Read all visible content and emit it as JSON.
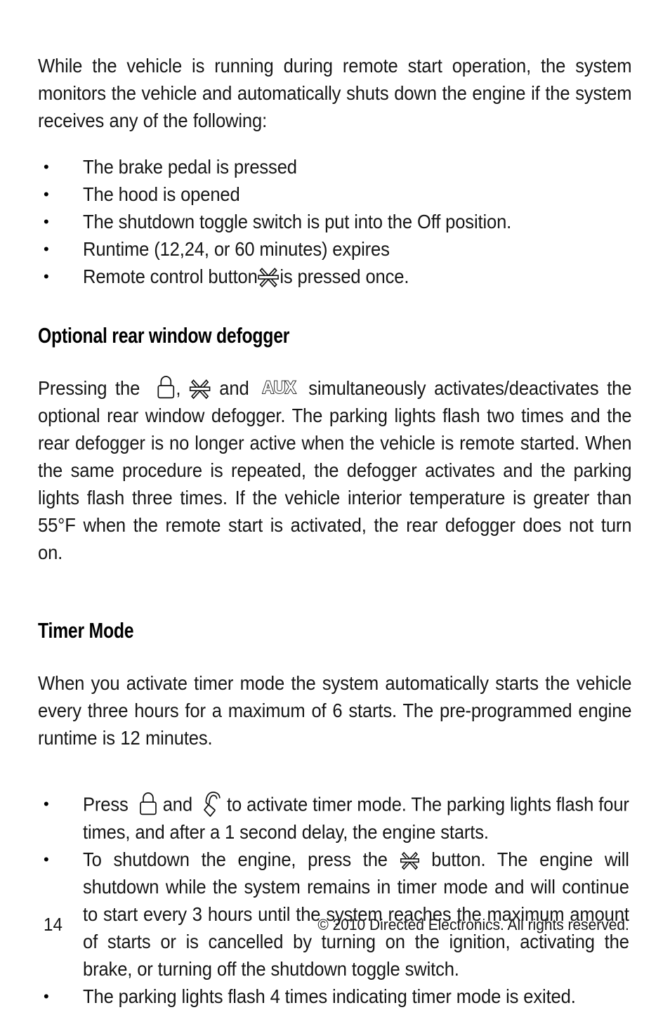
{
  "document": {
    "page_number": "14",
    "copyright": "© 2010 Directed Electronics. All rights reserved."
  },
  "intro": {
    "paragraph": "While the vehicle is running during remote start operation, the system monitors the vehicle and automatically shuts down the engine if the system receives any of the following:",
    "bullet_marker": "•",
    "bullets": [
      {
        "text": "The brake pedal is pressed"
      },
      {
        "text": "The hood is opened"
      },
      {
        "text": "The shutdown toggle switch is put into the Off position."
      },
      {
        "text": "Runtime (12,24, or 60 minutes) expires"
      },
      {
        "text_before": "Remote control button",
        "icon": "star-icon",
        "text_after": "is pressed once."
      }
    ]
  },
  "defogger": {
    "heading": "Optional rear window defogger",
    "text_1": "Pressing the",
    "icon_1": "lock-icon",
    "separator": ",",
    "icon_2": "star-icon",
    "text_2": "and",
    "icon_3": "aux-icon",
    "text_3": "simultaneously activates/deactivates the optional rear window defogger. The parking lights flash two times and the rear defogger is no longer active when the vehicle is remote started. When the same procedure is repeated, the defogger activates and the parking lights flash three times. If the vehicle interior temperature is greater than 55°F when the remote start is activated, the rear defogger does not turn on."
  },
  "timer_mode": {
    "heading": "Timer Mode",
    "paragraph": "When you activate timer mode the system automatically starts the vehicle every three hours for a maximum of 6 starts. The pre-programmed engine runtime is 12 minutes.",
    "bullet_marker": "•",
    "bullets": [
      {
        "text_before": "Press",
        "icon_1": "lock-icon",
        "text_middle": "and",
        "icon_2": "trunk-icon",
        "text_after": "to activate timer mode. The parking lights flash four times, and after a 1 second delay, the engine starts."
      },
      {
        "text_before": "To shutdown the engine, press the",
        "icon_1": "star-icon",
        "text_after": "button. The engine will shutdown while the system remains in timer mode and will continue to start every 3 hours until the system reaches the maximum amount of starts or is cancelled by turning on the ignition, activating the brake, or turning off the shutdown toggle switch."
      },
      {
        "text": "The parking lights flash 4 times indicating timer mode is exited."
      }
    ]
  },
  "colors": {
    "text": "#161616",
    "heading": "#000000",
    "background": "#ffffff"
  }
}
